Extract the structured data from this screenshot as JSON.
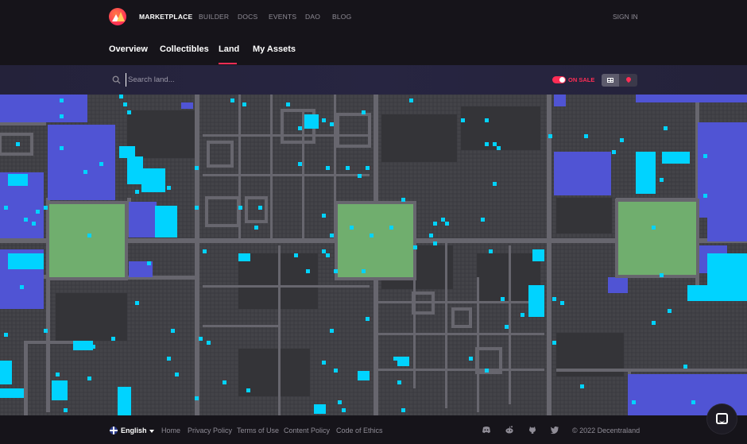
{
  "nav": {
    "brand": "MARKETPLACE",
    "links": [
      "BUILDER",
      "DOCS",
      "EVENTS",
      "DAO",
      "BLOG"
    ],
    "signin": "SIGN IN"
  },
  "tabs": [
    "Overview",
    "Collectibles",
    "Land",
    "My Assets"
  ],
  "active_tab": "Land",
  "search": {
    "placeholder": "Search land...",
    "value": ""
  },
  "filter": {
    "on_sale_label": "ON SALE",
    "on_sale_enabled": true
  },
  "view_modes": {
    "active": "grid-icon",
    "options": [
      "grid-icon",
      "map-pin-icon"
    ]
  },
  "colors": {
    "accent": "#ff2d55",
    "map_parcel": "#3a3a3f",
    "map_road": "#67666e",
    "map_plaza": "#70ae6e",
    "map_district": "#5054d4",
    "map_on_sale": "#00d3ff"
  },
  "footer": {
    "language": "English",
    "links": [
      "Home",
      "Privacy Policy",
      "Terms of Use",
      "Content Policy",
      "Code of Ethics"
    ],
    "social_icons": [
      "discord-icon",
      "reddit-icon",
      "github-icon",
      "twitter-icon"
    ],
    "copyright": "© 2022 Decentraland"
  }
}
